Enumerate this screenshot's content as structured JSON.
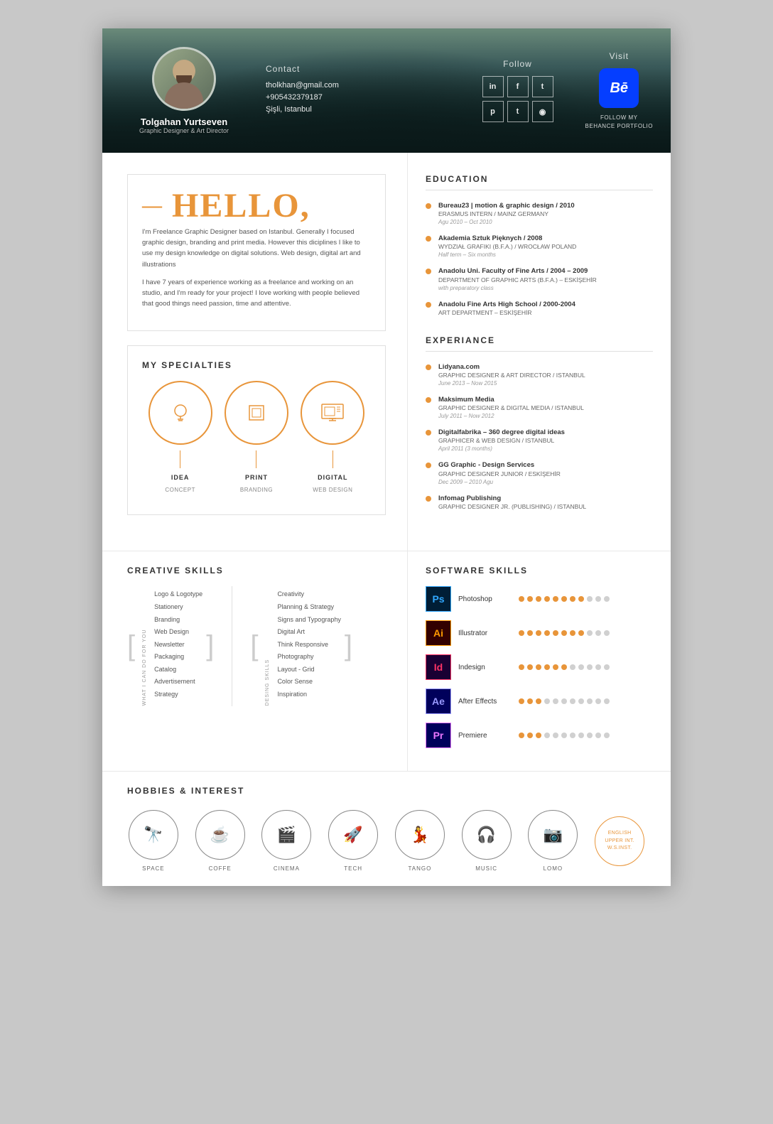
{
  "header": {
    "name": "Tolgahan Yurtseven",
    "title": "Graphic Designer & Art Director",
    "contact": {
      "label": "Contact",
      "email": "tholkhan@gmail.com",
      "phone": "+905432379187",
      "location": "Şişli, Istanbul"
    },
    "follow": {
      "label": "Follow",
      "networks": [
        "in",
        "f",
        "t",
        "p",
        "t",
        "◉"
      ]
    },
    "visit": {
      "label": "Visit",
      "behance_label": "FOLLOW MY\nBEHANCE PORTFOLIO",
      "behance_text": "Bē"
    }
  },
  "hello": {
    "greeting": "HELLO,",
    "dash": "—",
    "para1": "I'm Freelance Graphic Designer based on Istanbul. Generally I focused graphic design, branding and print media. However this diciplines I like to use my design knowledge on digital solutions. Web design, digital art and illustrations",
    "para2": "I have 7 years of experience working as a freelance and working on an studio, and I'm ready for your project! I love working with people believed that good things need passion, time and attentive."
  },
  "specialties": {
    "title": "MY SPECIALTIES",
    "items": [
      {
        "label": "IDEA",
        "sublabel": "CONCEPT"
      },
      {
        "label": "PRINT",
        "sublabel": "BRANDING"
      },
      {
        "label": "DIGITAL",
        "sublabel": "WEB DESIGN"
      }
    ]
  },
  "education": {
    "title": "EDUCATION",
    "items": [
      {
        "title": "Bureau23 | motion & graphic design / 2010",
        "subtitle": "ERASMUS INTERN / MAINZ GERMANY",
        "date": "Agu 2010 – Oct 2010"
      },
      {
        "title": "Akademia Sztuk Pięknych / 2008",
        "subtitle": "WYDZIAŁ GRAFIKI (B.F.A.) / WROCŁAW POLAND",
        "date": "Half term – Six months"
      },
      {
        "title": "Anadolu Uni. Faculty of Fine Arts / 2004 – 2009",
        "subtitle": "DEPARTMENT OF GRAPHIC ARTS (B.F.A.) – ESKİŞEHİR",
        "date": "with preparatory class"
      },
      {
        "title": "Anadolu Fine Arts High School / 2000-2004",
        "subtitle": "ART DEPARTMENT – ESKİŞEHİR",
        "date": ""
      }
    ]
  },
  "experience": {
    "title": "EXPERIANCE",
    "items": [
      {
        "title": "Lidyana.com",
        "subtitle": "GRAPHIC DESIGNER & ART DIRECTOR / ISTANBUL",
        "date": "June 2013 – Now 2015"
      },
      {
        "title": "Maksimum Media",
        "subtitle": "GRAPHIC DESIGNER & DIGITAL MEDIA / ISTANBUL",
        "date": "July 2011 – Now 2012"
      },
      {
        "title": "Digitalfabrika – 360 degree digital ideas",
        "subtitle": "GRAPHICER & WEB DESIGN / ISTANBUL",
        "date": "April 2011 (3 months)"
      },
      {
        "title": "GG Graphic - Design Services",
        "subtitle": "GRAPHIC DESIGNER JUNIOR / ESKİŞEHİR",
        "date": "Dec 2009 – 2010 Agu"
      },
      {
        "title": "Infomag Publishing",
        "subtitle": "GRAPHIC DESIGNER JR. (PUBLISHING) / ISTANBUL",
        "date": ""
      }
    ]
  },
  "creative_skills": {
    "title": "CREATIVE SKILLS",
    "what_label": "WHAT I CAN DO FOR YOU",
    "design_label": "DESING SKILLS",
    "col1": [
      "Logo & Logotype",
      "Stationery",
      "Branding",
      "Web Design",
      "Newsletter",
      "Packaging",
      "Catalog",
      "Advertisement",
      "Strategy"
    ],
    "col2": [
      "Creativity",
      "Planning & Strategy",
      "Signs and Typography",
      "Digital Art",
      "Think Responsive",
      "Photography",
      "Layout - Grid",
      "Color Sense",
      "Inspiration"
    ]
  },
  "software_skills": {
    "title": "SOFTWARE SKILLS",
    "items": [
      {
        "name": "Photoshop",
        "abbr": "Ps",
        "filled": 8,
        "empty": 3
      },
      {
        "name": "Illustrator",
        "abbr": "Ai",
        "filled": 8,
        "empty": 3
      },
      {
        "name": "Indesign",
        "abbr": "Id",
        "filled": 6,
        "empty": 5
      },
      {
        "name": "After Effects",
        "abbr": "Ae",
        "filled": 3,
        "empty": 8
      },
      {
        "name": "Premiere",
        "abbr": "Pr",
        "filled": 3,
        "empty": 8
      }
    ]
  },
  "hobbies": {
    "title": "HOBBIES & INTEREST",
    "items": [
      {
        "icon": "🔭",
        "label": "SPACE"
      },
      {
        "icon": "☕",
        "label": "COFFE"
      },
      {
        "icon": "🎬",
        "label": "CINEMA"
      },
      {
        "icon": "🚀",
        "label": "TECH"
      },
      {
        "icon": "💃",
        "label": "TANGO"
      },
      {
        "icon": "🎧",
        "label": "MUSIC"
      },
      {
        "icon": "📷",
        "label": "LOMO"
      }
    ],
    "english": {
      "lines": [
        "ENGLISH",
        "UPPER INT.",
        "W.S.INST."
      ]
    }
  }
}
